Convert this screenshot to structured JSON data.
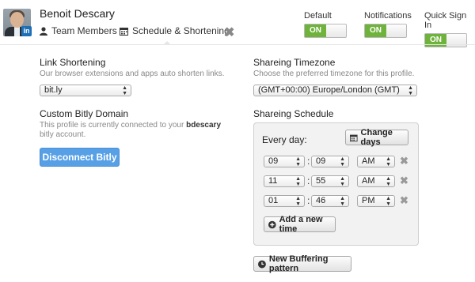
{
  "header": {
    "user_name": "Benoit Descary",
    "avatar_badge": "in",
    "tabs": [
      {
        "label": "Team Members",
        "icon": "person-icon"
      },
      {
        "label": "Schedule & Shortening",
        "icon": "calendar-icon"
      }
    ],
    "close_icon": "✖",
    "toggles": [
      {
        "label": "Default",
        "state": "ON"
      },
      {
        "label": "Notifications",
        "state": "ON"
      },
      {
        "label": "Quick Sign In",
        "state": "ON"
      }
    ]
  },
  "link_shortening": {
    "title": "Link Shortening",
    "description": "Our browser extensions and apps auto shorten links.",
    "selected": "bit.ly"
  },
  "bitly_domain": {
    "title": "Custom Bitly Domain",
    "description_prefix": "This profile is currently connected to your ",
    "account": "bdescary",
    "description_suffix": " bitly account.",
    "button_label": "Disconnect Bitly"
  },
  "timezone": {
    "title": "Shareing Timezone",
    "description": "Choose the preferred timezone for this profile.",
    "selected": "(GMT+00:00) Europe/London (GMT)"
  },
  "schedule": {
    "title": "Shareing Schedule",
    "every_day_label": "Every day:",
    "change_days_label": "Change days",
    "times": [
      {
        "hour": "09",
        "minute": "09",
        "period": "AM"
      },
      {
        "hour": "11",
        "minute": "55",
        "period": "AM"
      },
      {
        "hour": "01",
        "minute": "46",
        "period": "PM"
      }
    ],
    "add_time_label": "Add a new time",
    "new_pattern_label": "New Buffering pattern"
  },
  "colors": {
    "toggle_on": "#6fb23c",
    "primary_button": "#58a0e6"
  }
}
